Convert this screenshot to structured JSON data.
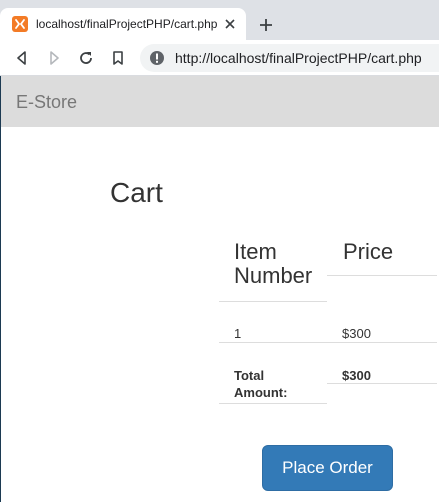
{
  "browser": {
    "tab_title": "localhost/finalProjectPHP/cart.php",
    "url": "http://localhost/finalProjectPHP/cart.php"
  },
  "navbar": {
    "brand": "E-Store"
  },
  "cart": {
    "title": "Cart",
    "columns": [
      "Item Number",
      "Price"
    ],
    "rows": [
      {
        "item_number": "1",
        "price": "$300"
      }
    ],
    "total_label": "Total Amount:",
    "total_value": "$300",
    "place_order_label": "Place Order"
  },
  "colors": {
    "navbar_bg": "#dcdcdc",
    "primary_button": "#337ab7",
    "favicon": "#f37b26"
  },
  "icons": {
    "favicon": "xampp-icon",
    "close": "close-icon",
    "new_tab": "plus-icon",
    "back": "back-arrow-icon",
    "forward": "forward-arrow-icon",
    "reload": "reload-icon",
    "bookmark": "bookmark-icon",
    "site_info": "info-icon"
  }
}
